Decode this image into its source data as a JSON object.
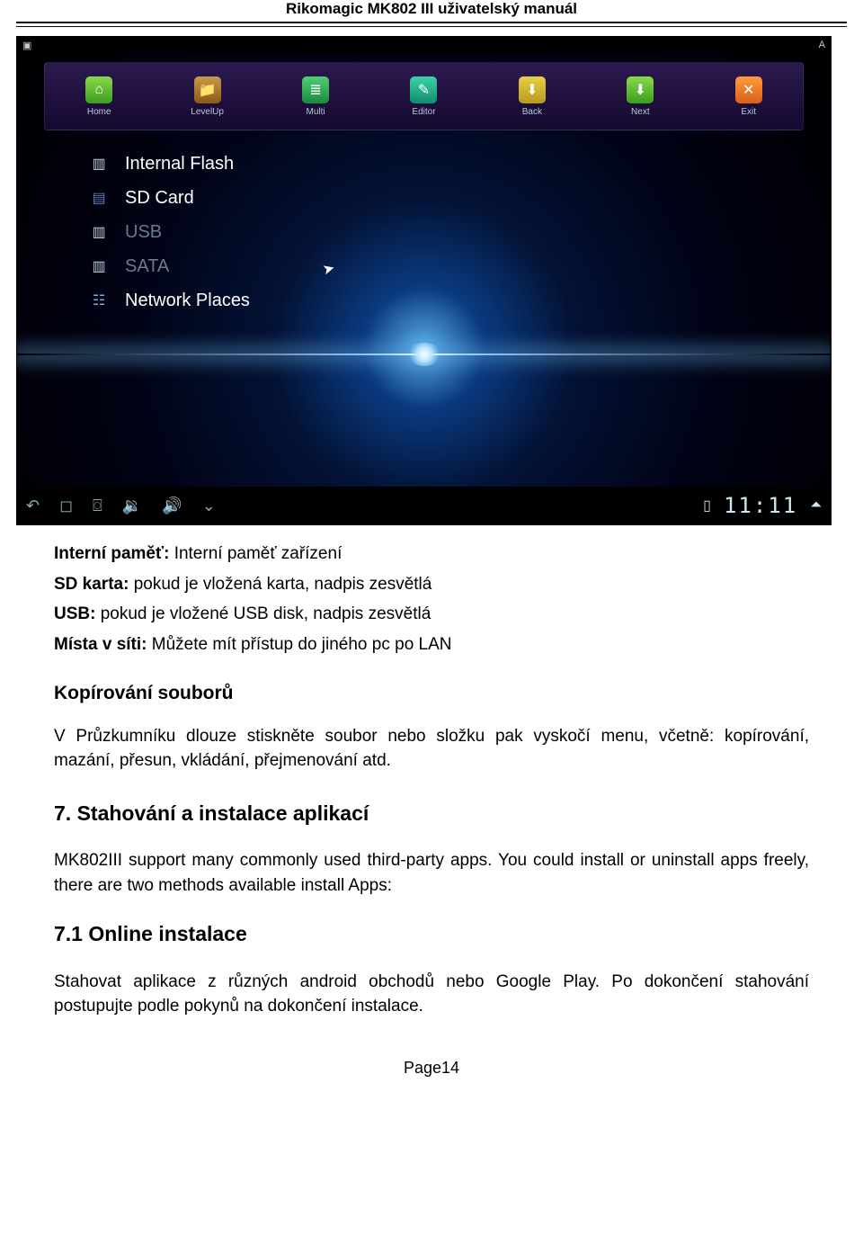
{
  "doc": {
    "header": "Rikomagic MK802 III uživatelský manuál",
    "page_label": "Page14"
  },
  "screenshot": {
    "statusbar": {
      "left_icon": "▣",
      "right_icon": "A"
    },
    "toolbar": {
      "items": [
        {
          "label": "Home",
          "data_name": "toolbar-home"
        },
        {
          "label": "LevelUp",
          "data_name": "toolbar-levelup"
        },
        {
          "label": "Multi",
          "data_name": "toolbar-multi"
        },
        {
          "label": "Editor",
          "data_name": "toolbar-editor"
        },
        {
          "label": "Back",
          "data_name": "toolbar-back"
        },
        {
          "label": "Next",
          "data_name": "toolbar-next"
        },
        {
          "label": "Exit",
          "data_name": "toolbar-exit"
        }
      ]
    },
    "storage": {
      "internal_flash": "Internal Flash",
      "sd_card": "SD Card",
      "usb": "USB",
      "sata": "SATA",
      "network": "Network Places"
    },
    "navbar": {
      "clock": "11:11"
    }
  },
  "body": {
    "def_internal_label": "Interní paměť:",
    "def_internal_value": "Interní paměť zařízení",
    "def_sd_label": "SD karta:",
    "def_sd_value": "pokud je vložená karta, nadpis zesvětlá",
    "def_usb_label": "USB:",
    "def_usb_value": "pokud je vložené USB disk, nadpis zesvětlá",
    "def_net_label": "Místa v síti:",
    "def_net_value": "Můžete mít přístup do jiného pc po LAN",
    "copy_title": "Kopírování souborů",
    "copy_text": "V Průzkumníku dlouze stiskněte soubor nebo složku pak vyskočí menu, včetně: kopírování, mazání, přesun, vkládání, přejmenování atd.",
    "ch7_title": "7. Stahování a instalace aplikací",
    "ch7_text": "MK802III support many commonly used third-party apps. You could install or uninstall apps freely, there are two methods available install Apps:",
    "ch7_1_title": "7.1 Online instalace",
    "ch7_1_text": "Stahovat aplikace z různých android obchodů nebo Google Play. Po dokončení stahování postupujte podle pokynů na dokončení instalace."
  }
}
